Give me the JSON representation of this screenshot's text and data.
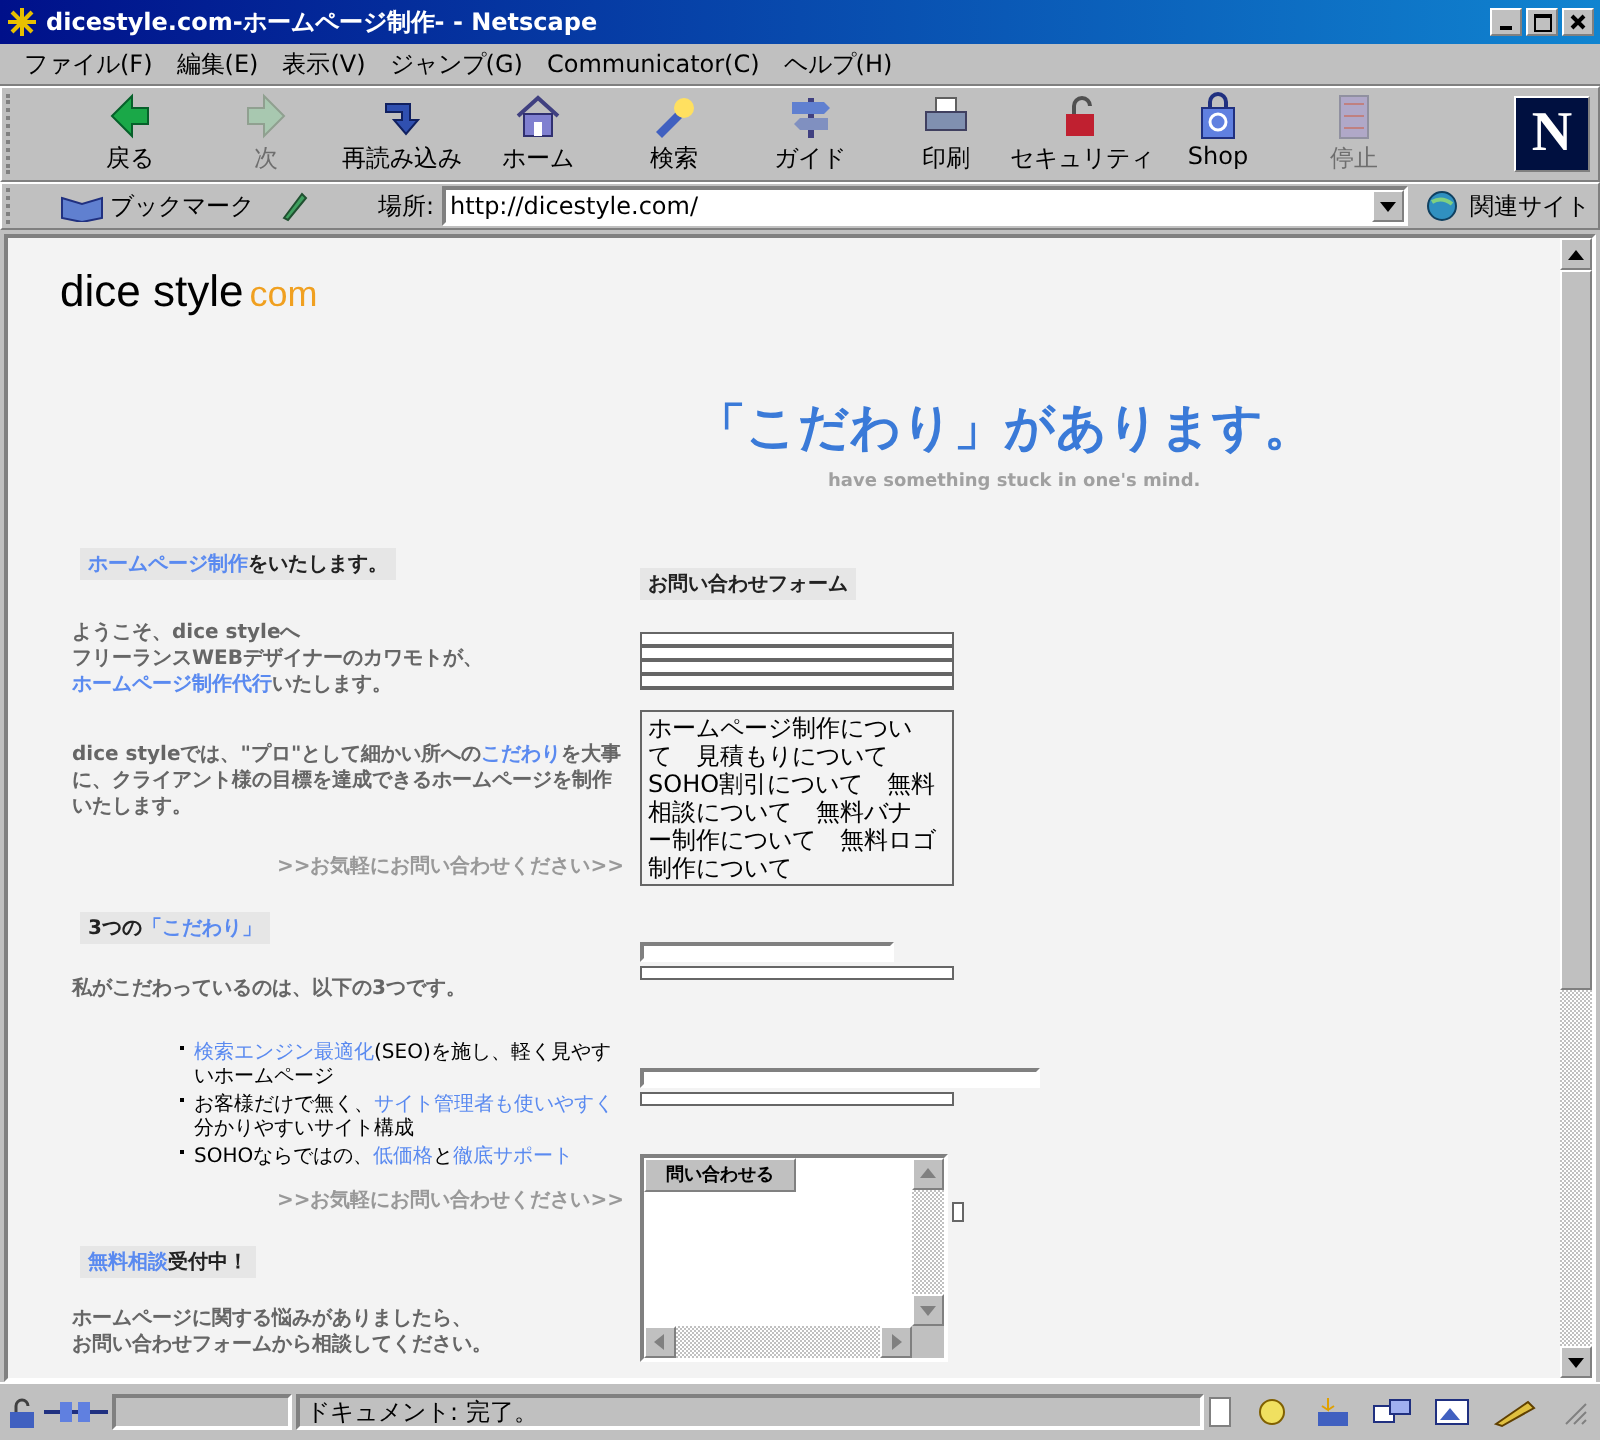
{
  "window": {
    "title": "dicestyle.com-ホームページ制作- - Netscape"
  },
  "menu": [
    "ファイル(F)",
    "編集(E)",
    "表示(V)",
    "ジャンプ(G)",
    "Communicator(C)",
    "ヘルプ(H)"
  ],
  "toolbar": [
    {
      "label": "戻る",
      "disabled": false
    },
    {
      "label": "次",
      "disabled": true
    },
    {
      "label": "再読み込み",
      "disabled": false
    },
    {
      "label": "ホーム",
      "disabled": false
    },
    {
      "label": "検索",
      "disabled": false
    },
    {
      "label": "ガイド",
      "disabled": false
    },
    {
      "label": "印刷",
      "disabled": false
    },
    {
      "label": "セキュリティ",
      "disabled": false
    },
    {
      "label": "Shop",
      "disabled": false
    },
    {
      "label": "停止",
      "disabled": true
    }
  ],
  "brand_logo": "N",
  "location_bar": {
    "bookmarks": "ブックマーク",
    "label": "場所:",
    "url": "http://dicestyle.com/",
    "related": "関連サイト"
  },
  "page": {
    "logo": {
      "name": "dice style",
      "suffix": "com"
    },
    "headline": "「こだわり」があります。",
    "tagline": "have something stuck in one's mind.",
    "left": [
      {
        "kind": "heading",
        "parts": [
          {
            "text": "ホームページ制作",
            "kind": "link"
          },
          {
            "text": "をいたします。",
            "kind": "text"
          }
        ]
      },
      {
        "kind": "lines",
        "lines": [
          [
            {
              "text": "ようこそ、dice styleへ",
              "kind": "text"
            }
          ],
          [
            {
              "text": "フリーランスWEBデザイナーのカワモトが、",
              "kind": "text"
            }
          ],
          [
            {
              "text": "ホームページ制作代行",
              "kind": "link"
            },
            {
              "text": "いたします。",
              "kind": "text"
            }
          ]
        ]
      },
      {
        "kind": "paragraph",
        "parts": [
          {
            "text": "dice styleでは、\"プロ\"として細かい所への",
            "kind": "text"
          },
          {
            "text": "こだわり",
            "kind": "link"
          },
          {
            "text": "を大事に、クライアント様の目標を達成できるホームページを制作いたします。",
            "kind": "text"
          }
        ]
      },
      {
        "kind": "more",
        "parts": [
          {
            "text": ">>お気軽にお問い合わせください>>",
            "kind": "link"
          }
        ]
      },
      {
        "kind": "heading",
        "parts": [
          {
            "text": "3つの",
            "kind": "text"
          },
          {
            "text": "「こだわり」",
            "kind": "link"
          }
        ]
      },
      {
        "kind": "paragraph",
        "parts": [
          {
            "text": "私がこだわっているのは、以下の3つです。",
            "kind": "text"
          }
        ]
      },
      {
        "kind": "list",
        "items": [
          [
            {
              "text": "検索エンジン最適化",
              "kind": "link"
            },
            {
              "text": "(SEO)を施し、軽く見やすいホームページ",
              "kind": "text"
            }
          ],
          [
            {
              "text": "お客様だけで無く、",
              "kind": "text"
            },
            {
              "text": "サイト管理者も使いやすく",
              "kind": "link"
            },
            {
              "text": "分かりやすいサイト構成",
              "kind": "text"
            }
          ],
          [
            {
              "text": "SOHOならではの、",
              "kind": "text"
            },
            {
              "text": "低価格",
              "kind": "link"
            },
            {
              "text": "と",
              "kind": "text"
            },
            {
              "text": "徹底サポート",
              "kind": "link"
            }
          ]
        ]
      },
      {
        "kind": "more",
        "parts": [
          {
            "text": ">>お気軽にお問い合わせください>>",
            "kind": "link"
          }
        ]
      },
      {
        "kind": "heading",
        "parts": [
          {
            "text": "無料相談",
            "kind": "link"
          },
          {
            "text": "受付中！",
            "kind": "text"
          }
        ]
      },
      {
        "kind": "lines",
        "lines": [
          [
            {
              "text": "ホームページに関する悩みがありましたら、",
              "kind": "text"
            }
          ],
          [
            {
              "text": "お問い合わせフォームから相談してください。",
              "kind": "text"
            }
          ]
        ]
      }
    ],
    "form": {
      "title": "お問い合わせフォーム",
      "topics": [
        "ホームページ制作につい",
        "て　見積もりについて",
        "SOHO割引について　無料",
        "相談について　無料バナ",
        "ー制作について　無料ロゴ",
        "制作について"
      ],
      "checkbox": {
        "checked": false
      },
      "submit": "問い合わせる"
    }
  },
  "status_bar": {
    "text": "ドキュメント: 完了。"
  }
}
